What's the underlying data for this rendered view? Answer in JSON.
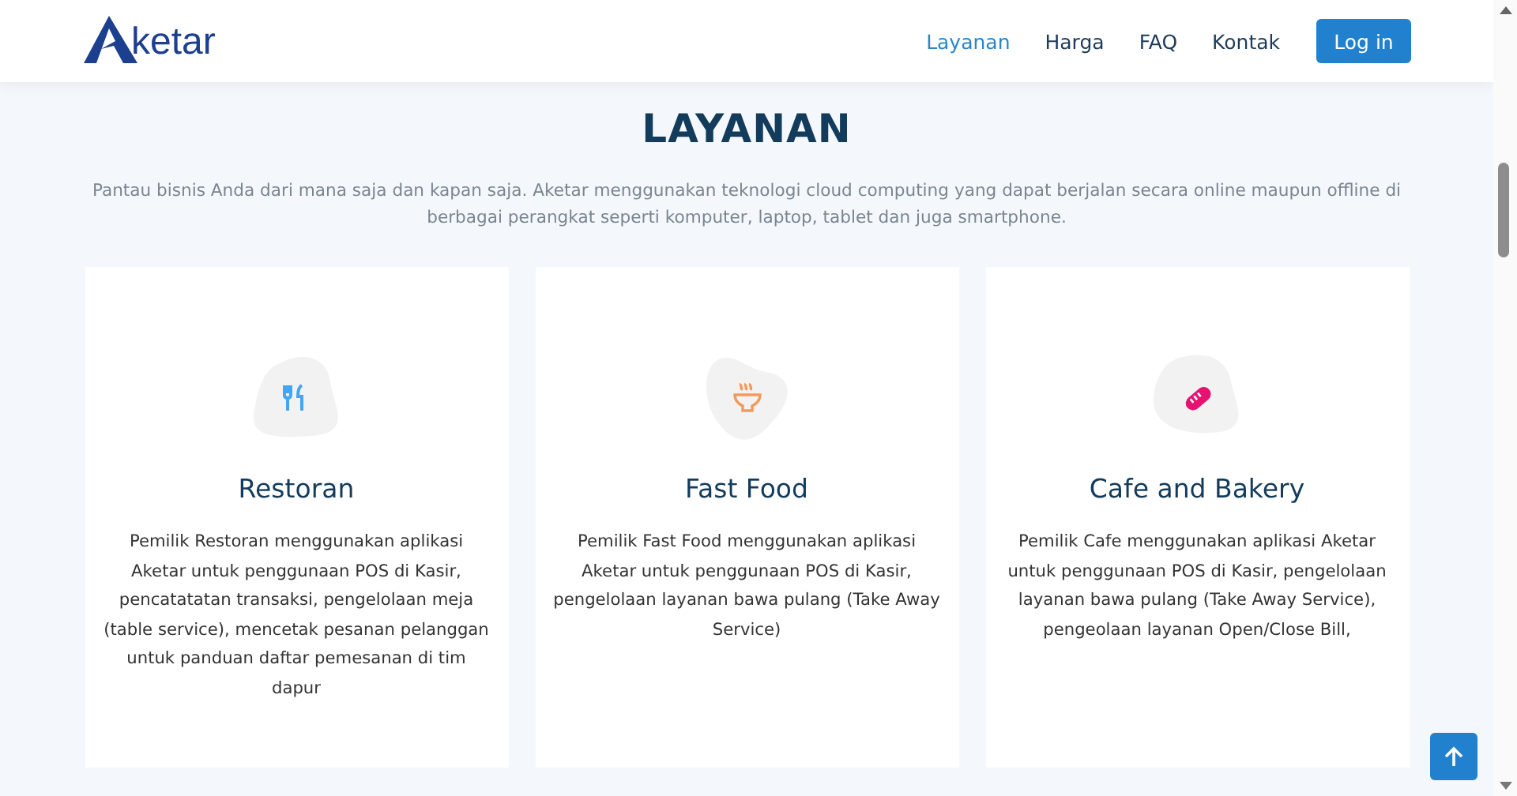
{
  "header": {
    "logo": "ketar",
    "nav": [
      {
        "label": "Layanan",
        "selected": true
      },
      {
        "label": "Harga",
        "selected": false
      },
      {
        "label": "FAQ",
        "selected": false
      },
      {
        "label": "Kontak",
        "selected": false
      }
    ],
    "login": "Log in"
  },
  "section": {
    "title": "LAYANAN",
    "intro": "Pantau bisnis Anda dari mana saja dan kapan saja. Aketar menggunakan teknologi cloud computing yang dapat berjalan secara online maupun offline di berbagai perangkat seperti komputer, laptop, tablet dan juga smartphone.",
    "cards": [
      {
        "kind": "restaurant",
        "title": "Restoran",
        "text": "Pemilik Restoran menggunakan aplikasi Aketar untuk penggunaan POS di Kasir, pencatatatan transaksi, pengelolaan meja (table service), mencetak pesanan pelanggan untuk panduan daftar pemesanan di tim dapur"
      },
      {
        "kind": "fastfood",
        "title": "Fast Food",
        "text": "Pemilik Fast Food menggunakan aplikasi Aketar untuk penggunaan POS di Kasir, pengelolaan layanan bawa pulang (Take Away Service)"
      },
      {
        "kind": "bakery",
        "title": "Cafe and Bakery",
        "text": "Pemilik Cafe menggunakan aplikasi Aketar untuk penggunaan POS di Kasir, pengelolaan layanan bawa pulang (Take Away Service), pengeolaan layanan Open/Close Bill,"
      }
    ]
  }
}
